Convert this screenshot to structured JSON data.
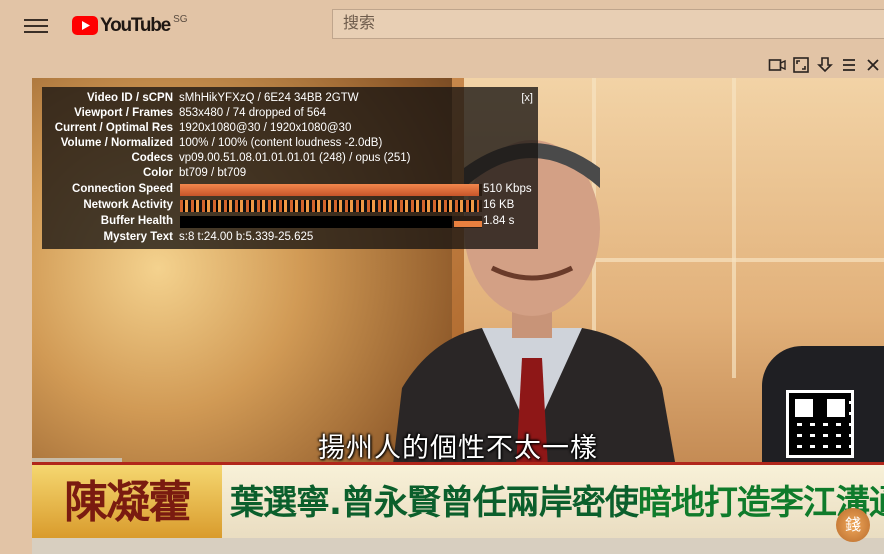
{
  "header": {
    "logo_text": "YouTube",
    "region": "SG",
    "search_placeholder": "搜索"
  },
  "colors": {
    "background": "#e2c4a6",
    "logo_red": "#ff0000",
    "stats_bg": "#181412"
  },
  "icons": {
    "menu": "hamburger-menu-icon",
    "miniplayer": "miniplayer-icon",
    "fullscreen": "fullscreen-icon",
    "download": "download-icon",
    "queue": "queue-icon",
    "close": "close-icon"
  },
  "stats": {
    "close_label": "[x]",
    "rows": [
      {
        "label": "Video ID / sCPN",
        "value": "sMhHikYFXzQ / 6E24 34BB 2GTW"
      },
      {
        "label": "Viewport / Frames",
        "value": "853x480 / 74 dropped of 564"
      },
      {
        "label": "Current / Optimal Res",
        "value": "1920x1080@30 / 1920x1080@30"
      },
      {
        "label": "Volume / Normalized",
        "value": "100% / 100% (content loudness -2.0dB)"
      },
      {
        "label": "Codecs",
        "value": "vp09.00.51.08.01.01.01.01 (248) / opus (251)"
      },
      {
        "label": "Color",
        "value": "bt709 / bt709"
      }
    ],
    "connection": {
      "label": "Connection Speed",
      "value": "510 Kbps",
      "level": 0.99
    },
    "network": {
      "label": "Network Activity",
      "value": "16 KB",
      "level": 0.99
    },
    "buffer": {
      "label": "Buffer Health",
      "value": "1.84 s",
      "level": 0.9
    },
    "mystery": {
      "label": "Mystery Text",
      "value": "s:8 t:24.00 b:5.339-25.625"
    }
  },
  "video": {
    "subtitle": "揚州人的個性不太一樣",
    "banner_name": "陳凝藿",
    "headline_part1": "葉選寧.曾永賢曾任兩岸密使",
    "headline_part2": "暗地打造李江溝通專線?!",
    "channel_logo": "錢"
  }
}
